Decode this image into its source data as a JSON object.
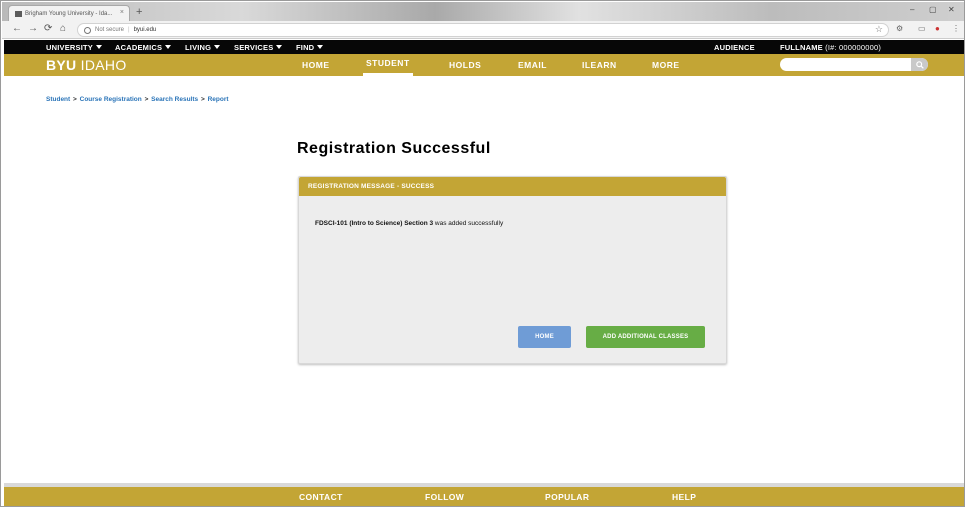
{
  "browser": {
    "tab_title": "Brigham Young University - Ida...",
    "tab_close": "×",
    "new_tab": "+",
    "nav": {
      "back": "←",
      "forward": "→",
      "reload": "⟳",
      "home": "⌂"
    },
    "security_label": "Not secure",
    "url": "byui.edu",
    "star": "☆",
    "window_controls": {
      "minimize": "–",
      "maximize": "▢",
      "close": "✕"
    }
  },
  "topbar": {
    "menus": [
      "UNIVERSITY",
      "ACADEMICS",
      "LIVING",
      "SERVICES",
      "FIND"
    ],
    "audience": "AUDIENCE",
    "fullname": "FULLNAME",
    "id_text": "(I#: 000000000)"
  },
  "header": {
    "logo_bold": "BYU",
    "logo_light": "IDAHO",
    "nav": [
      "HOME",
      "STUDENT",
      "HOLDS",
      "EMAIL",
      "ILEARN",
      "MORE"
    ],
    "active_nav": "STUDENT",
    "search_placeholder": ""
  },
  "breadcrumb": [
    {
      "label": "Student"
    },
    {
      "label": "Course Registration"
    },
    {
      "label": "Search Results"
    },
    {
      "label": "Report"
    }
  ],
  "breadcrumb_sep": ">",
  "page_title": "Registration Successful",
  "card": {
    "header": "REGISTRATION MESSAGE - SUCCESS",
    "message_bold": "FDSCI-101 (Intro to Science) Section 3",
    "message_rest": " was added successfully",
    "home_button": "HOME",
    "add_button": "ADD ADDITIONAL CLASSES"
  },
  "footer": [
    "CONTACT",
    "FOLLOW",
    "POPULAR",
    "HELP"
  ],
  "colors": {
    "gold": "#c3a535",
    "link": "#2a74b8",
    "home_btn": "#6f9cd6",
    "add_btn": "#67ad45"
  }
}
